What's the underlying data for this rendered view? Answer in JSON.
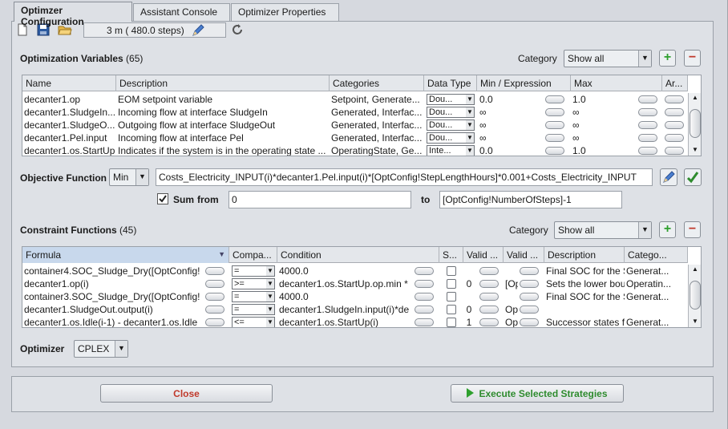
{
  "tabs": [
    {
      "label": "Optimzer Configuration"
    },
    {
      "label": "Assistant Console"
    },
    {
      "label": "Optimizer Properties"
    }
  ],
  "toolbar": {
    "steps_label": "3 m ( 480.0 steps)"
  },
  "variables": {
    "title": "Optimization Variables",
    "count": "(65)",
    "category_label": "Category",
    "category_value": "Show all",
    "columns": [
      "Name",
      "Description",
      "Categories",
      "Data Type",
      "Min / Expression",
      "Max",
      "Ar..."
    ],
    "rows": [
      {
        "name": "decanter1.op",
        "description": "EOM setpoint variable",
        "categories": "Setpoint, Generate...",
        "dtype": "Dou...",
        "min": "0.0",
        "max": "1.0"
      },
      {
        "name": "decanter1.SludgeIn...",
        "description": "Incoming flow at interface SludgeIn",
        "categories": "Generated, Interfac...",
        "dtype": "Dou...",
        "min": "∞",
        "max": "∞"
      },
      {
        "name": "decanter1.SludgeO...",
        "description": "Outgoing flow at interface SludgeOut",
        "categories": "Generated, Interfac...",
        "dtype": "Dou...",
        "min": "∞",
        "max": "∞"
      },
      {
        "name": "decanter1.Pel.input",
        "description": "Incoming flow at interface Pel",
        "categories": "Generated, Interfac...",
        "dtype": "Dou...",
        "min": "∞",
        "max": "∞"
      },
      {
        "name": "decanter1.os.StartUp",
        "description": "Indicates if the system is in the operating state ...",
        "categories": "OperatingState, Ge...",
        "dtype": "Inte...",
        "min": "0.0",
        "max": "1.0"
      }
    ]
  },
  "objective": {
    "label": "Objective Function",
    "mode": "Min",
    "expression": "Costs_Electricity_INPUT(i)*decanter1.Pel.input(i)*[OptConfig!StepLengthHours]*0.001+Costs_Electricity_INPUT",
    "sum_label": "Sum",
    "from_label": "from",
    "from_value": "0",
    "to_label": "to",
    "to_value": "[OptConfig!NumberOfSteps]-1"
  },
  "constraints": {
    "title": "Constraint Functions",
    "count": "(45)",
    "category_label": "Category",
    "category_value": "Show all",
    "columns": [
      "Formula",
      "Compa...",
      "Condition",
      "S...",
      "Valid ...",
      "Valid ...",
      "Description",
      "Catego..."
    ],
    "rows": [
      {
        "formula": "container4.SOC_Sludge_Dry([OptConfig!",
        "comp": "=",
        "condition": "4000.0",
        "s": "",
        "valid1": "",
        "valid2": "",
        "description": "Final SOC for the Slu...",
        "category": "Generat..."
      },
      {
        "formula": "decanter1.op(i)",
        "comp": ">=",
        "condition": "decanter1.os.StartUp.op.min *",
        "s": "0",
        "valid1": "",
        "valid2": "[Op",
        "description": "Sets the lower boun...",
        "category": "Operatin..."
      },
      {
        "formula": "container3.SOC_Sludge_Dry([OptConfig!",
        "comp": "=",
        "condition": "4000.0",
        "s": "",
        "valid1": "",
        "valid2": "",
        "description": "Final SOC for the Slu...",
        "category": "Generat..."
      },
      {
        "formula": "decanter1.SludgeOut.output(i)",
        "comp": "=",
        "condition": "decanter1.SludgeIn.input(i)*de",
        "s": "0",
        "valid1": "",
        "valid2": "Op",
        "description": "",
        "category": ""
      },
      {
        "formula": "decanter1.os.Idle(i-1) - decanter1.os.Idle",
        "comp": "<=",
        "condition": "decanter1.os.StartUp(i)",
        "s": "1",
        "valid1": "",
        "valid2": "Op",
        "description": "Successor states for...",
        "category": "Generat..."
      }
    ]
  },
  "optimizer": {
    "label": "Optimizer",
    "value": "CPLEX"
  },
  "buttons": {
    "close": "Close",
    "execute": "Execute Selected Strategies"
  },
  "colors": {
    "close_text": "#c0392b",
    "execute_text": "#2e8b2e",
    "add_icon": "#2ea02e",
    "remove_icon": "#c0392b"
  }
}
